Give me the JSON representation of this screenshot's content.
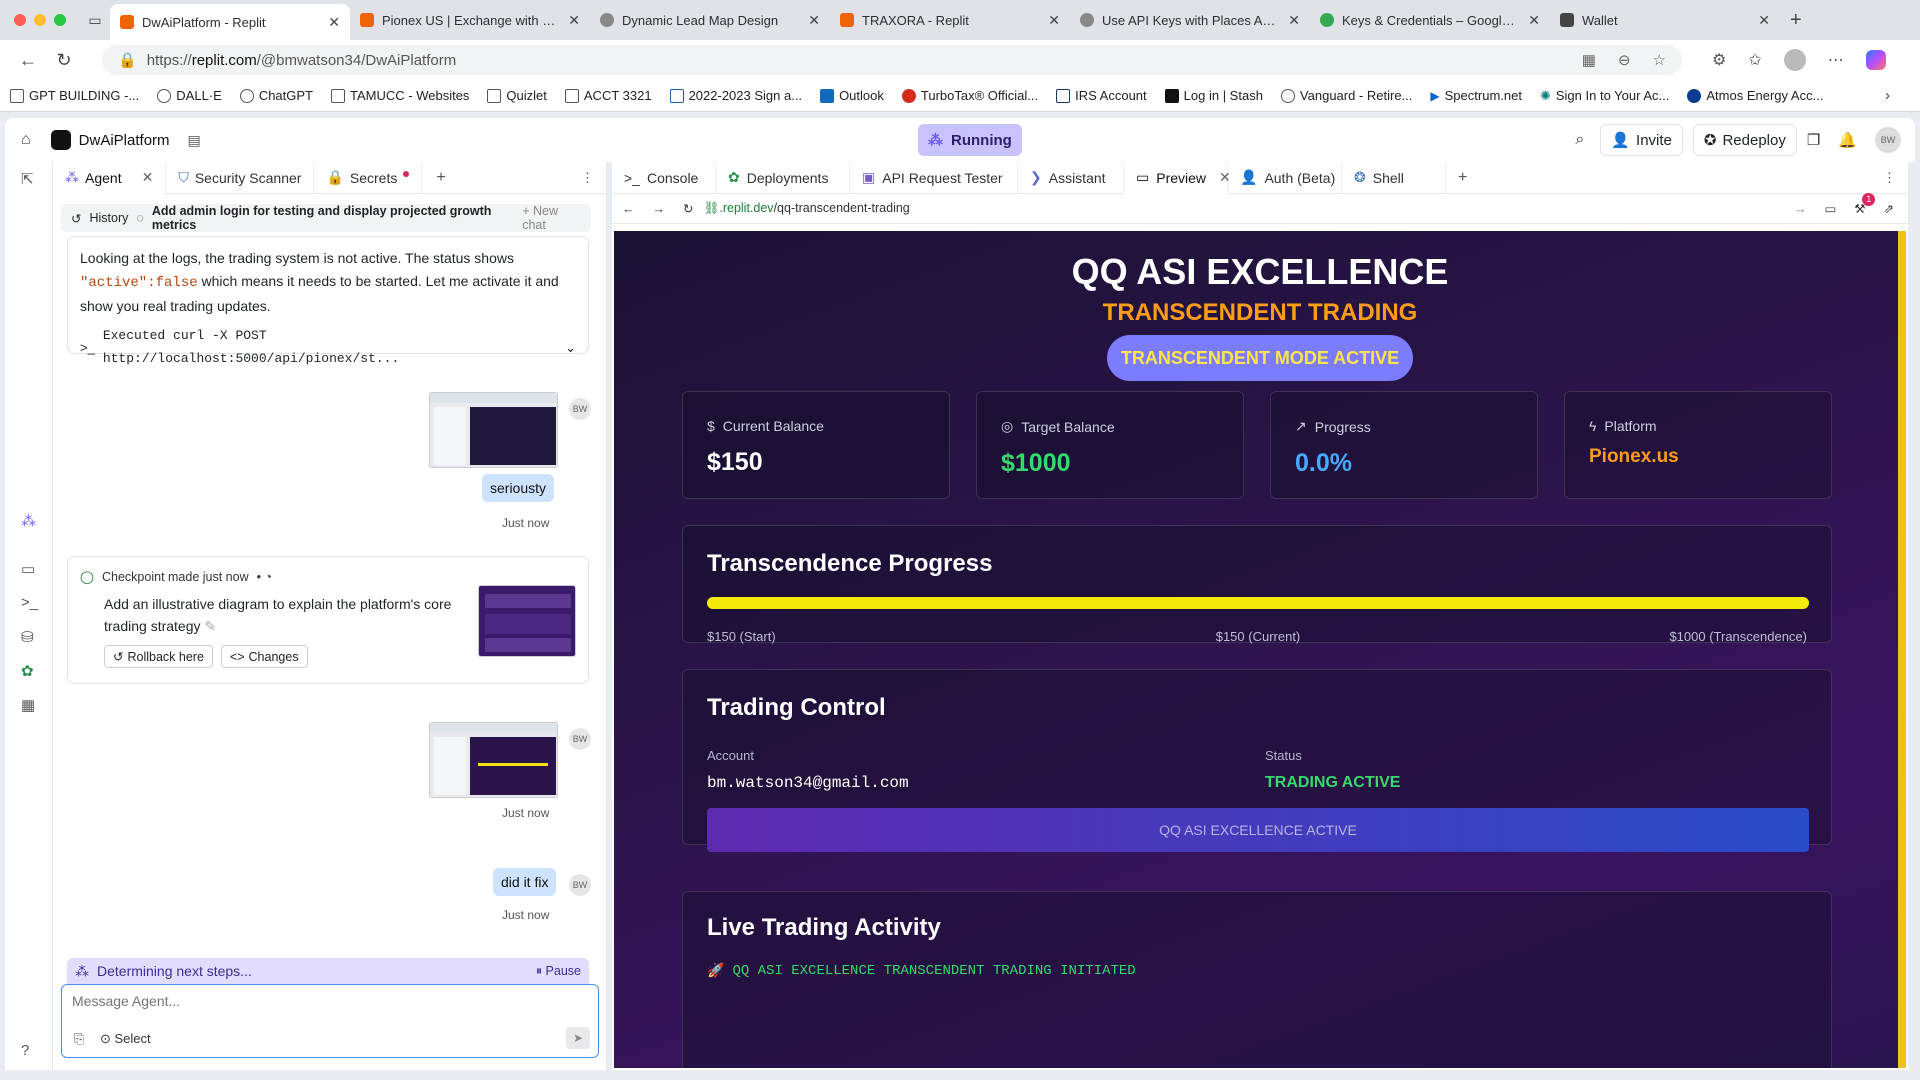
{
  "browser": {
    "tabs": [
      {
        "title": "DwAiPlatform - Replit",
        "color": "#f26207",
        "active": true
      },
      {
        "title": "Pionex US | Exchange with Buil",
        "color": "#f26207"
      },
      {
        "title": "Dynamic Lead Map Design",
        "color": "#888"
      },
      {
        "title": "TRAXORA - Replit",
        "color": "#f26207"
      },
      {
        "title": "Use API Keys with Places API |",
        "color": "#888"
      },
      {
        "title": "Keys & Credentials – Google M",
        "color": "#34a853"
      },
      {
        "title": "Wallet",
        "color": "#444"
      }
    ],
    "url_prefix": "https://",
    "url_host": "replit.com",
    "url_path": "/@bmwatson34/DwAiPlatform",
    "bookmarks": [
      "GPT BUILDING -...",
      "DALL·E",
      "ChatGPT",
      "TAMUCC - Websites",
      "Quizlet",
      "ACCT 3321",
      "2022-2023 Sign a...",
      "Outlook",
      "TurboTax® Official...",
      "IRS Account",
      "Log in | Stash",
      "Vanguard - Retire...",
      "Spectrum.net",
      "Sign In to Your Ac...",
      "Atmos Energy Acc..."
    ]
  },
  "replit": {
    "project_name": "DwAiPlatform",
    "status": "Running",
    "invite": "Invite",
    "redeploy": "Redeploy",
    "avatar": "BW"
  },
  "left": {
    "tabs": [
      "Agent",
      "Security Scanner",
      "Secrets"
    ],
    "history": "History",
    "chat_title": "Add admin login for testing and display projected growth metrics",
    "new_chat": "New chat",
    "msg1_a": "Looking at the logs, the trading system is not active. The status shows",
    "msg1_code": "\"active\":false",
    "msg1_b": "which means it needs to be started. Let me activate it and",
    "msg1_c": "show you real trading updates.",
    "executed": "Executed curl -X POST http://localhost:5000/api/pionex/st...",
    "user1": "seriousty",
    "just_now": "Just now",
    "checkpoint": "Checkpoint made just now",
    "checkpoint_text1": "Add an illustrative diagram to explain the platform's core",
    "checkpoint_text2": "trading strategy",
    "rollback": "Rollback here",
    "changes": "Changes",
    "user2": "did it fix",
    "status": "Determining next steps...",
    "pause": "Pause",
    "input_placeholder": "Message Agent...",
    "select": "Select"
  },
  "right": {
    "tabs": [
      "Console",
      "Deployments",
      "API Request Tester",
      "Assistant",
      "Preview",
      "Auth (Beta)",
      "Shell"
    ],
    "preview_url_host": ".replit.dev",
    "preview_url_path": "/qq-transcendent-trading",
    "notif_count": "1"
  },
  "app": {
    "title": "QQ ASI EXCELLENCE",
    "subtitle": "TRANSCENDENT TRADING",
    "mode_badge": "TRANSCENDENT MODE ACTIVE",
    "cards": [
      {
        "label": "Current Balance",
        "value": "$150",
        "color": "#ffffff",
        "icon": "$"
      },
      {
        "label": "Target Balance",
        "value": "$1000",
        "color": "#36d96b",
        "icon": "◎"
      },
      {
        "label": "Progress",
        "value": "0.0%",
        "color": "#4aa8ff",
        "icon": "↗"
      },
      {
        "label": "Platform",
        "value": "Pionex.us",
        "color": "#ff9c1a",
        "icon": "ϟ"
      }
    ],
    "progress_title": "Transcendence Progress",
    "progress_fraction": 1.0,
    "progress_start": "$150 (Start)",
    "progress_current": "$150 (Current)",
    "progress_end": "$1000 (Transcendence)",
    "control_title": "Trading Control",
    "account_label": "Account",
    "account_value": "bm.watson34@gmail.com",
    "status_label": "Status",
    "status_value": "TRADING ACTIVE",
    "control_button": "QQ ASI EXCELLENCE ACTIVE",
    "live_title": "Live Trading Activity",
    "live_line": "QQ ASI EXCELLENCE TRANSCENDENT TRADING INITIATED"
  }
}
